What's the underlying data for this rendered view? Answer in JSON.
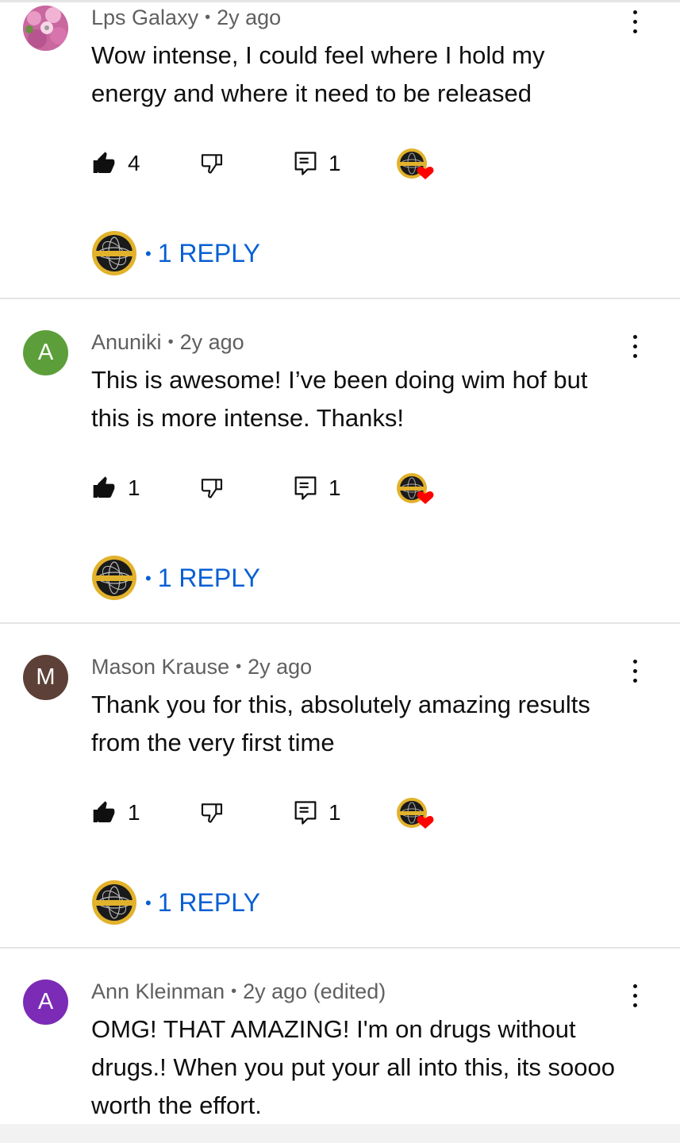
{
  "comments": [
    {
      "author": "Lps Galaxy",
      "age": "2y ago",
      "text_lines": [
        "Wow intense, I could feel where I hold my",
        "energy and where it need to be released"
      ],
      "likes": "4",
      "replies_count": "1",
      "reply_label": "1 REPLY",
      "avatar_type": "photo",
      "avatar_icon": "flower-photo"
    },
    {
      "author": "Anuniki",
      "age": "2y ago",
      "text_lines": [
        "This is awesome! I’ve been doing wim hof but",
        "this is more intense. Thanks!"
      ],
      "likes": "1",
      "replies_count": "1",
      "reply_label": "1 REPLY",
      "avatar_letter": "A",
      "avatar_color": "#5c9f3a"
    },
    {
      "author": "Mason Krause",
      "age": "2y ago",
      "text_lines": [
        "Thank you for this, absolutely amazing results",
        "from the very first time"
      ],
      "likes": "1",
      "replies_count": "1",
      "reply_label": "1 REPLY",
      "avatar_letter": "M",
      "avatar_color": "#5d4037"
    },
    {
      "author": "Ann Kleinman",
      "age": "2y ago (edited)",
      "text_lines": [
        "OMG! THAT AMAZING! I'm on drugs without",
        "drugs.! When you put your all into this, its soooo",
        "worth the effort."
      ],
      "avatar_letter": "A",
      "avatar_color": "#7b2bb5"
    }
  ],
  "colors": {
    "reply_blue": "#065fd4",
    "meta_gray": "#606060",
    "heart_red": "#ff0000",
    "logo_gold": "#e2b22c"
  },
  "icons": [
    "like-icon",
    "dislike-icon",
    "reply-icon",
    "creator-heart-icon",
    "more-vert-icon",
    "channel-logo-icon"
  ]
}
